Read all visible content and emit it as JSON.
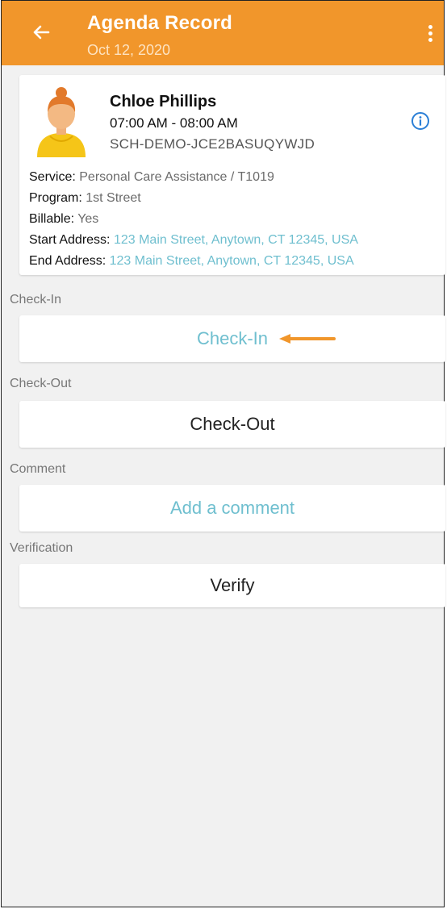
{
  "header": {
    "title": "Agenda Record",
    "date": "Oct 12, 2020",
    "icons": {
      "back": "arrow-left-icon",
      "menu": "more-vert-icon"
    },
    "colors": {
      "bar": "#f1962b"
    }
  },
  "client": {
    "name": "Chloe Phillips",
    "time": "07:00 AM - 08:00 AM",
    "code": "SCH-DEMO-JCE2BASUQYWJD",
    "details": {
      "service_label": "Service:",
      "service_value": "Personal Care Assistance / T1019",
      "program_label": "Program:",
      "program_value": "1st Street",
      "billable_label": "Billable:",
      "billable_value": "Yes",
      "start_label": "Start Address:",
      "start_value": "123 Main Street, Anytown, CT 12345, USA",
      "end_label": "End Address:",
      "end_value": "123 Main Street, Anytown, CT 12345, USA"
    },
    "icons": {
      "avatar": "user-avatar-icon",
      "info": "info-icon"
    }
  },
  "sections": {
    "checkin_label": "Check-In",
    "checkin_button": "Check-In",
    "checkout_label": "Check-Out",
    "checkout_button": "Check-Out",
    "comment_label": "Comment",
    "comment_button": "Add a comment",
    "verification_label": "Verification",
    "verify_button": "Verify"
  },
  "colors": {
    "accent_orange": "#f1962b",
    "link_teal": "#6fbfcf"
  }
}
